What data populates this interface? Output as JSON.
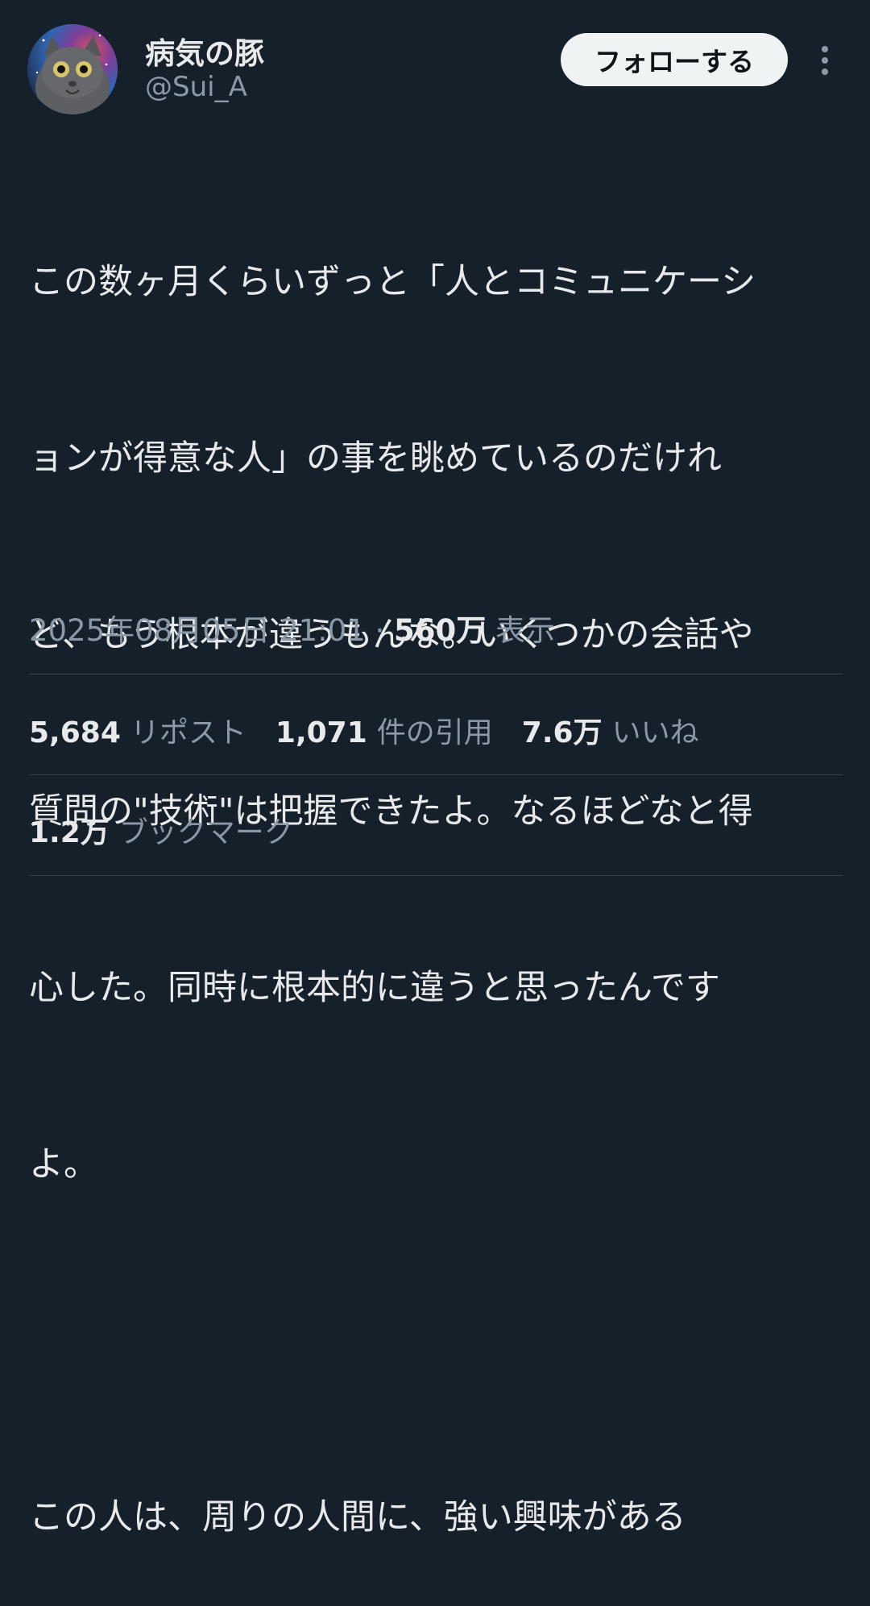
{
  "author": {
    "display_name": "病気の豚",
    "handle": "@Sui_A"
  },
  "follow_label": "フォローする",
  "more_icon": "more-vertical-icon",
  "tweet_lines": [
    "この数ヶ月くらいずっと「人とコミュニケーシ",
    "ョンが得意な人」の事を眺めているのだけれ",
    "ど、もう根本が違うもんな。いくつかの会話や",
    "質問の\"技術\"は把握できたよ。なるほどなと得",
    "心した。同時に根本的に違うと思ったんです",
    "よ。",
    "",
    "この人は、周りの人間に、強い興味がある"
  ],
  "meta": {
    "timestamp": "2025年08月05日 21:01",
    "separator": "·",
    "views_count": "560万",
    "views_label": "表示"
  },
  "stats": {
    "reposts_count": "5,684",
    "reposts_label": "リポスト",
    "quotes_count": "1,071",
    "quotes_label": "件の引用",
    "likes_count": "7.6万",
    "likes_label": "いいね",
    "bookmarks_count": "1.2万",
    "bookmarks_label": "ブックマーク"
  },
  "colors": {
    "background": "#15202b",
    "text_primary": "#e7e9ea",
    "text_secondary": "#8b98a5",
    "divider": "#38444d",
    "button_bg": "#eff3f4"
  }
}
